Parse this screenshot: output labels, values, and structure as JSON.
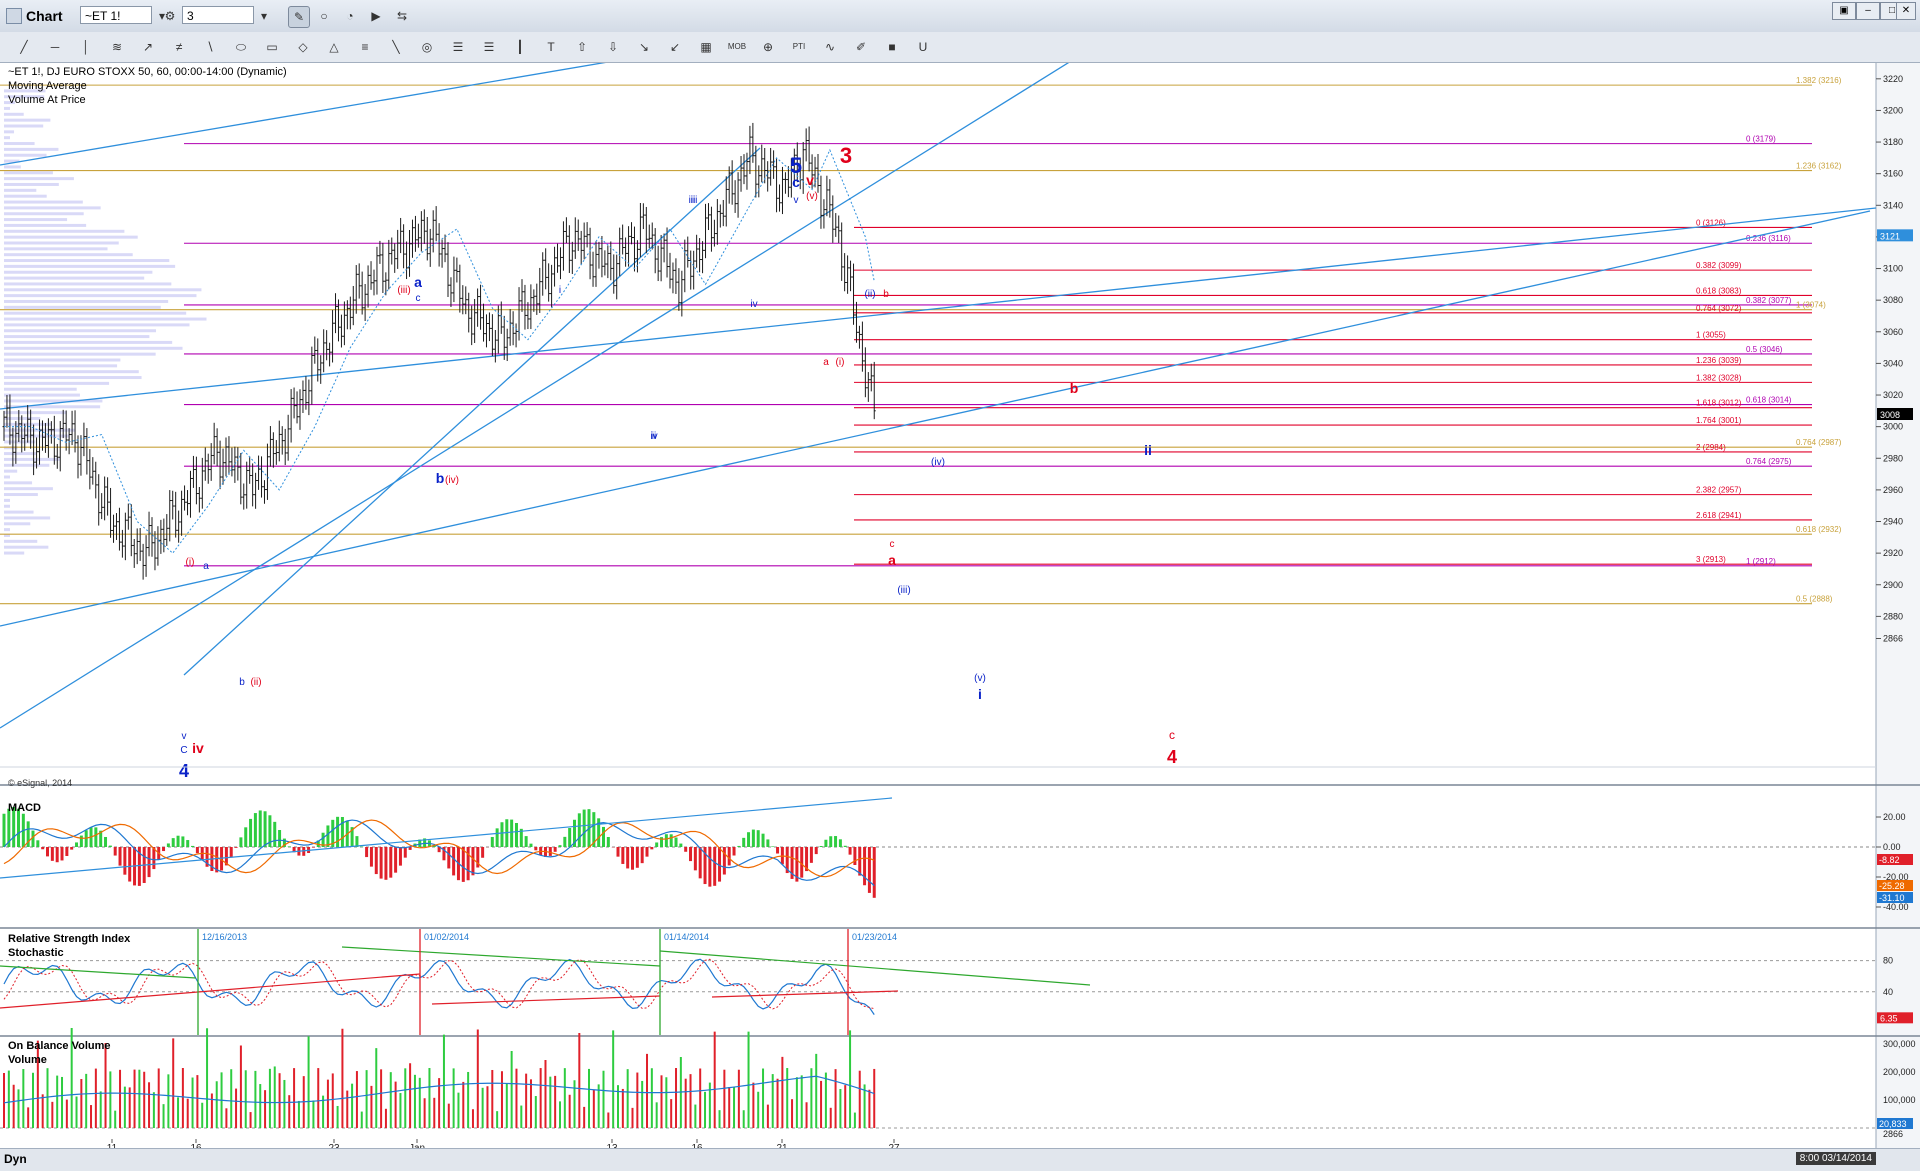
{
  "window": {
    "title": "Chart",
    "symbol": "~ET 1!",
    "interval": "3"
  },
  "win_controls": [
    "▣",
    "–",
    "□",
    "✕"
  ],
  "toolbar_top": [
    "✎",
    "○",
    "◔",
    "▶",
    "⇆"
  ],
  "toolbar_tools": [
    "╱",
    "─",
    "│",
    "≋",
    "↗",
    "≠",
    "∖",
    "⬭",
    "▭",
    "◇",
    "△",
    "≡",
    "╲",
    "◎",
    "☰",
    "☰",
    "┃",
    "T",
    "⇧",
    "⇩",
    "↘",
    "↙",
    "▦",
    "MOB",
    "⊕",
    "PTI",
    "∿",
    "✐",
    "■",
    "U"
  ],
  "legend": {
    "line1": "~ET 1!, DJ EURO STOXX 50, 60, 00:00-14:00 (Dynamic)",
    "line2": "Moving Average",
    "line3": "Volume At Price"
  },
  "copyright": "© eSignal, 2014",
  "panes": {
    "macd": "MACD",
    "rsi": "Relative Strength Index",
    "stoch": "Stochastic",
    "obv": "On Balance Volume",
    "vol": "Volume"
  },
  "status": {
    "dyn": "Dyn",
    "clock": "8:00 03/14/2014"
  },
  "colors": {
    "fib_gold": "#c8a23c",
    "fib_magenta": "#b000b0",
    "fib_red": "#e0002a",
    "channel": "#2f8fdc",
    "wave_blue": "#0a22c8",
    "wave_red": "#e0001a",
    "candle": "#1a1a1a"
  },
  "chart_data": {
    "type": "line",
    "title": "~ET 1!, DJ EURO STOXX 50, 60",
    "x_ticks": [
      "11",
      "16",
      "23",
      "Jan",
      "13",
      "16",
      "21",
      "27"
    ],
    "y_ticks": [
      3220,
      3200,
      3180,
      3160,
      3140,
      3120,
      3100,
      3080,
      3060,
      3040,
      3020,
      3000,
      2980,
      2960,
      2940,
      2920,
      2900,
      2880,
      2866
    ],
    "ylim": [
      2860,
      3230
    ],
    "series": [
      {
        "name": "~ET 1!",
        "x": [
          0,
          4,
          8,
          12,
          16,
          20,
          24,
          28,
          32,
          36,
          40,
          44,
          48,
          52,
          56,
          60,
          64,
          68,
          72,
          76,
          80,
          84,
          88,
          90,
          94,
          98
        ],
        "values": [
          3000,
          2990,
          2995,
          2940,
          2920,
          2950,
          2985,
          2960,
          3000,
          3050,
          3085,
          3110,
          3125,
          3075,
          3055,
          3085,
          3120,
          3100,
          3125,
          3090,
          3130,
          3170,
          3150,
          3175,
          3120,
          3008
        ]
      }
    ],
    "last_price": "3008",
    "last_price_alt": "3121",
    "fib_levels": [
      {
        "label": "1.382 (3216)",
        "value": 3216,
        "color": "gold"
      },
      {
        "label": "0 (3179)",
        "value": 3179,
        "color": "magenta"
      },
      {
        "label": "1.236 (3162)",
        "value": 3162,
        "color": "gold"
      },
      {
        "label": "0 (3126)",
        "value": 3126,
        "color": "red"
      },
      {
        "label": "0.236 (3116)",
        "value": 3116,
        "color": "magenta"
      },
      {
        "label": "0.382 (3099)",
        "value": 3099,
        "color": "red"
      },
      {
        "label": "0.618 (3083)",
        "value": 3083,
        "color": "red"
      },
      {
        "label": "0.382 (3077)",
        "value": 3077,
        "color": "magenta"
      },
      {
        "label": "1 (3074)",
        "value": 3074,
        "color": "gold"
      },
      {
        "label": "0.764 (3072)",
        "value": 3072,
        "color": "red"
      },
      {
        "label": "1 (3055)",
        "value": 3055,
        "color": "red"
      },
      {
        "label": "0.5 (3046)",
        "value": 3046,
        "color": "magenta"
      },
      {
        "label": "1.236 (3039)",
        "value": 3039,
        "color": "red"
      },
      {
        "label": "1.382 (3028)",
        "value": 3028,
        "color": "red"
      },
      {
        "label": "0.618 (3014)",
        "value": 3014,
        "color": "magenta"
      },
      {
        "label": "1.618 (3012)",
        "value": 3012,
        "color": "red"
      },
      {
        "label": "1.764 (3001)",
        "value": 3001,
        "color": "red"
      },
      {
        "label": "0.764 (2987)",
        "value": 2987,
        "color": "gold"
      },
      {
        "label": "2 (2984)",
        "value": 2984,
        "color": "red"
      },
      {
        "label": "0.764 (2975)",
        "value": 2975,
        "color": "magenta"
      },
      {
        "label": "2.382 (2957)",
        "value": 2957,
        "color": "red"
      },
      {
        "label": "2.618 (2941)",
        "value": 2941,
        "color": "red"
      },
      {
        "label": "0.618 (2932)",
        "value": 2932,
        "color": "gold"
      },
      {
        "label": "3 (2913)",
        "value": 2913,
        "color": "red"
      },
      {
        "label": "1 (2912)",
        "value": 2912,
        "color": "magenta"
      },
      {
        "label": "0.5 (2888)",
        "value": 2888,
        "color": "gold"
      }
    ],
    "wave_labels": [
      {
        "text": "5",
        "color": "blue"
      },
      {
        "text": "3",
        "color": "red"
      },
      {
        "text": "c",
        "color": "blue"
      },
      {
        "text": "v",
        "color": "red"
      },
      {
        "text": "v",
        "color": "blue"
      },
      {
        "text": "(v)",
        "color": "red"
      },
      {
        "text": "iii",
        "color": "blue"
      },
      {
        "text": "a",
        "color": "blue"
      },
      {
        "text": "(iii)",
        "color": "red"
      },
      {
        "text": "c",
        "color": "blue"
      },
      {
        "text": "i",
        "color": "blue"
      },
      {
        "text": "iv",
        "color": "blue"
      },
      {
        "text": "(ii)",
        "color": "blue"
      },
      {
        "text": "b",
        "color": "red"
      },
      {
        "text": "a",
        "color": "red"
      },
      {
        "text": "(i)",
        "color": "red"
      },
      {
        "text": "b",
        "color": "red"
      },
      {
        "text": "ii",
        "color": "blue"
      },
      {
        "text": "(iv)",
        "color": "blue"
      },
      {
        "text": "ii",
        "color": "blue"
      },
      {
        "text": "b",
        "color": "blue"
      },
      {
        "text": "(iv)",
        "color": "red"
      },
      {
        "text": "iv",
        "color": "blue"
      },
      {
        "text": "(i)",
        "color": "red"
      },
      {
        "text": "a",
        "color": "blue"
      },
      {
        "text": "iii",
        "color": "blue"
      },
      {
        "text": "b",
        "color": "blue"
      },
      {
        "text": "(ii)",
        "color": "red"
      },
      {
        "text": "c",
        "color": "red"
      },
      {
        "text": "a",
        "color": "red"
      },
      {
        "text": "(iii)",
        "color": "blue"
      },
      {
        "text": "(v)",
        "color": "blue"
      },
      {
        "text": "i",
        "color": "blue"
      },
      {
        "text": "c",
        "color": "red"
      },
      {
        "text": "4",
        "color": "red"
      },
      {
        "text": "v",
        "color": "blue"
      },
      {
        "text": "C",
        "color": "blue"
      },
      {
        "text": "iv",
        "color": "red"
      },
      {
        "text": "4",
        "color": "blue"
      }
    ],
    "macd_ticks": [
      "20.00",
      "0.00",
      "-20.00",
      "-40.00"
    ],
    "macd_values": [
      "-8.82",
      "-25.28",
      "-31.10"
    ],
    "rsi_ticks": [
      "80",
      "40"
    ],
    "rsi_value": "6.35",
    "rsi_dates": [
      "12/16/2013",
      "01/02/2014",
      "01/14/2014",
      "01/23/2014"
    ],
    "obv_ticks": [
      "300,000",
      "200,000",
      "100,000"
    ],
    "obv_value": "20,833",
    "obv_floor": "2866"
  }
}
